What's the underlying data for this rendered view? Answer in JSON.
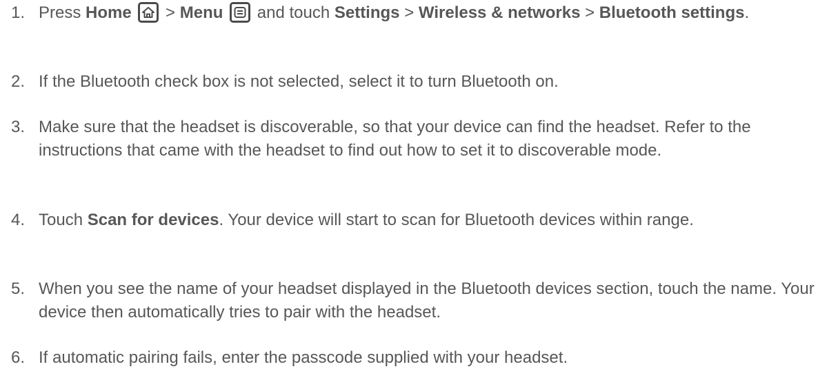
{
  "steps": [
    {
      "num": "1.",
      "t1": "Press ",
      "home_label": "Home",
      "t2": " > ",
      "menu_label": "Menu",
      "t3": " and touch ",
      "settings": "Settings",
      "t4": " > ",
      "wireless": "Wireless & networks",
      "t5": " > ",
      "bluetooth_settings": "Bluetooth settings",
      "t6": "."
    },
    {
      "num": "2.",
      "text": "If the Bluetooth check box is not selected, select it to turn Bluetooth on."
    },
    {
      "num": "3.",
      "text": "Make sure that the headset is discoverable, so that your device can find the headset. Refer to the instructions that came with the headset to find out how to set it to discoverable mode."
    },
    {
      "num": "4.",
      "t1": "Touch ",
      "scan": "Scan for devices",
      "t2": ". Your device will start to scan for Bluetooth devices within range."
    },
    {
      "num": "5.",
      "text": "When you see the name of your headset displayed in the Bluetooth devices section, touch the name. Your device then automatically tries to pair with the headset."
    },
    {
      "num": "6.",
      "text": "If automatic pairing fails, enter the passcode supplied with your headset."
    }
  ],
  "icons": {
    "home": "home-key-icon",
    "menu": "menu-key-icon"
  },
  "colors": {
    "text": "#575757",
    "icon_border": "#4a4a4a"
  }
}
